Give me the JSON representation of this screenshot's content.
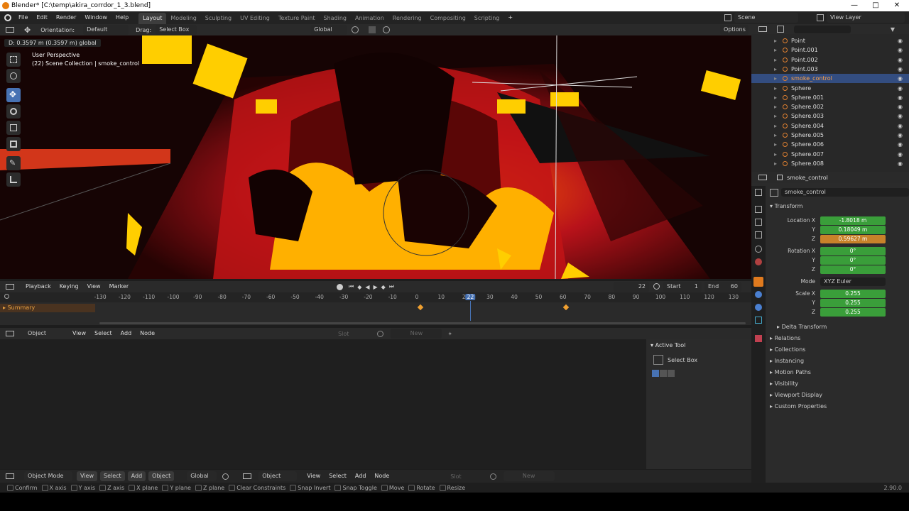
{
  "window": {
    "title": "Blender* [C:\\temp\\akira_corrdor_1_3.blend]",
    "minimize": "—",
    "maximize": "□",
    "close": "✕"
  },
  "menu": [
    "File",
    "Edit",
    "Render",
    "Window",
    "Help"
  ],
  "workspaces": [
    "Layout",
    "Modeling",
    "Sculpting",
    "UV Editing",
    "Texture Paint",
    "Shading",
    "Animation",
    "Rendering",
    "Compositing",
    "Scripting"
  ],
  "add_workspace": "+",
  "scene": "Scene",
  "view_layer": "View Layer",
  "header3d": {
    "orientation_label": "Orientation:",
    "orientation": "Default",
    "drag_label": "Drag:",
    "drag": "Select Box",
    "transform_space": "Global",
    "options": "Options"
  },
  "viewport": {
    "status": "D: 0.3597 m (0.3597 m) global",
    "perspective": "User Perspective",
    "collection": "(22) Scene Collection | smoke_control"
  },
  "outliner": {
    "search_placeholder": "",
    "items": [
      {
        "name": "Point",
        "selected": false
      },
      {
        "name": "Point.001",
        "selected": false
      },
      {
        "name": "Point.002",
        "selected": false
      },
      {
        "name": "Point.003",
        "selected": false
      },
      {
        "name": "smoke_control",
        "selected": true
      },
      {
        "name": "Sphere",
        "selected": false
      },
      {
        "name": "Sphere.001",
        "selected": false
      },
      {
        "name": "Sphere.002",
        "selected": false
      },
      {
        "name": "Sphere.003",
        "selected": false
      },
      {
        "name": "Sphere.004",
        "selected": false
      },
      {
        "name": "Sphere.005",
        "selected": false
      },
      {
        "name": "Sphere.006",
        "selected": false
      },
      {
        "name": "Sphere.007",
        "selected": false
      },
      {
        "name": "Sphere.008",
        "selected": false
      }
    ]
  },
  "properties": {
    "context": "smoke_control",
    "object_name": "smoke_control",
    "transform_label": "Transform",
    "location_label": "Location X",
    "location": [
      "-1.8018 m",
      "0.18049 m",
      "0.59627 m"
    ],
    "rotation_label": "Rotation X",
    "rotation": [
      "0°",
      "0°",
      "0°"
    ],
    "mode_label": "Mode",
    "mode": "XYZ Euler",
    "scale_label": "Scale X",
    "scale": [
      "0.255",
      "0.255",
      "0.255"
    ],
    "axis_y": "Y",
    "axis_z": "Z",
    "delta_transform": "Delta Transform",
    "sections": [
      "Relations",
      "Collections",
      "Instancing",
      "Motion Paths",
      "Visibility",
      "Viewport Display",
      "Custom Properties"
    ],
    "colors": {
      "location": "#3a9e3a",
      "location_keyed": "#c8822a",
      "rotation": "#3a9e3a",
      "scale": "#3a9e3a"
    }
  },
  "timeline": {
    "menus": [
      "Playback",
      "Keying",
      "View",
      "Marker"
    ],
    "current_frame": "22",
    "start_label": "Start",
    "start": "1",
    "end_label": "End",
    "end": "60",
    "summary": "Summary",
    "ticks": [
      "-130",
      "-120",
      "-110",
      "-100",
      "-90",
      "-80",
      "-70",
      "-60",
      "-50",
      "-40",
      "-30",
      "-20",
      "-10",
      "0",
      "10",
      "20",
      "22",
      "30",
      "40",
      "50",
      "60",
      "70",
      "80",
      "90",
      "100",
      "110",
      "120",
      "130"
    ]
  },
  "node_editor": {
    "mode": "Object",
    "menus": [
      "View",
      "Select",
      "Add",
      "Node"
    ],
    "slot": "Slot",
    "new": "New",
    "active_tool_label": "Active Tool",
    "active_tool": "Select Box"
  },
  "bottom_header": {
    "mode": "Object Mode",
    "menus": [
      "View",
      "Select",
      "Add",
      "Object"
    ],
    "transform_space": "Global",
    "editor_mode": "Object",
    "editor_menus": [
      "View",
      "Select",
      "Add",
      "Node"
    ],
    "slot": "Slot",
    "new": "New"
  },
  "statusbar": {
    "hints": [
      "Confirm",
      "X axis",
      "Y axis",
      "Z axis",
      "X plane",
      "Y plane",
      "Z plane",
      "Clear Constraints",
      "Snap Invert",
      "Snap Toggle",
      "Move",
      "Rotate",
      "Resize"
    ],
    "version": "2.90.0"
  }
}
